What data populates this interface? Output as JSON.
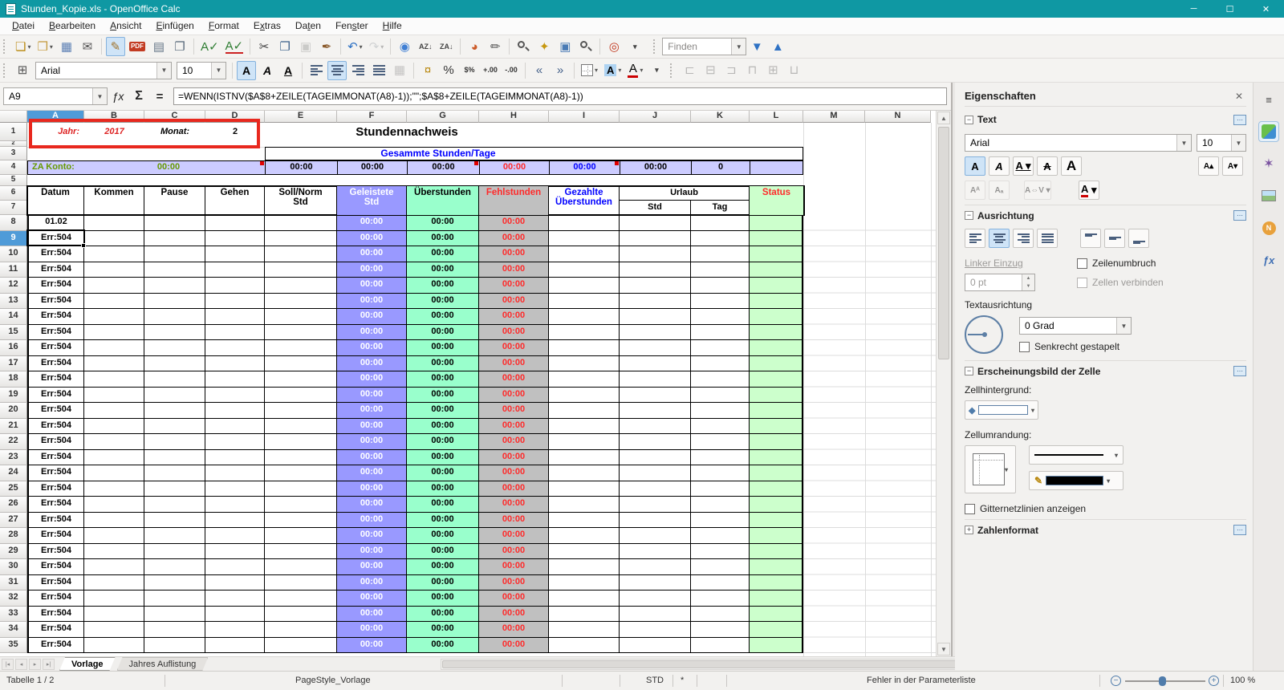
{
  "window": {
    "title": "Stunden_Kopie.xls - OpenOffice Calc",
    "minimize": "─",
    "maximize": "☐",
    "close": "✕"
  },
  "colors": {
    "titlebar": "#0f98a3",
    "selection_blue": "#4f9bd8",
    "lavender": "#ccccff",
    "purple": "#9999ff",
    "mint": "#99ffcc",
    "gray": "#c0c0c0",
    "lightgreen": "#ccffcc",
    "red_text": "#ff2a2a",
    "blue_text": "#0000ff",
    "green_text": "#669900",
    "annotation_red": "#e8281e"
  },
  "menu": {
    "items": [
      {
        "label": "Datei",
        "accel": 0
      },
      {
        "label": "Bearbeiten",
        "accel": 0
      },
      {
        "label": "Ansicht",
        "accel": 0
      },
      {
        "label": "Einfügen",
        "accel": 0
      },
      {
        "label": "Format",
        "accel": 0
      },
      {
        "label": "Extras",
        "accel": 1
      },
      {
        "label": "Daten",
        "accel": 2
      },
      {
        "label": "Fenster",
        "accel": 3
      },
      {
        "label": "Hilfe",
        "accel": 0
      }
    ]
  },
  "toolbar_standard": {
    "buttons": [
      {
        "name": "new-document",
        "glyph": "❏",
        "color": "#b8860b",
        "dropdown": true
      },
      {
        "name": "open",
        "glyph": "❒",
        "color": "#c49a3c",
        "dropdown": true
      },
      {
        "name": "save",
        "glyph": "▦",
        "color": "#5b7fb4"
      },
      {
        "name": "email",
        "glyph": "✉",
        "color": "#555555"
      },
      {
        "sep": true
      },
      {
        "name": "edit-mode",
        "glyph": "✎",
        "color": "#a0722a",
        "active": true
      },
      {
        "name": "export-pdf",
        "text": "PDF",
        "color": "#ffffff",
        "bg": "#c23b22"
      },
      {
        "name": "print",
        "glyph": "▤",
        "color": "#667788"
      },
      {
        "name": "page-preview",
        "glyph": "❐",
        "color": "#556677"
      },
      {
        "sep": true
      },
      {
        "name": "spellcheck",
        "text": "A✓",
        "color": "#2e7d32"
      },
      {
        "name": "auto-spellcheck",
        "text": "A✓",
        "color": "#2e7d32",
        "underline": true
      },
      {
        "sep": true
      },
      {
        "name": "cut",
        "glyph": "✂",
        "color": "#444444"
      },
      {
        "name": "copy",
        "glyph": "❐",
        "color": "#3a5f8a"
      },
      {
        "name": "paste",
        "glyph": "▣",
        "color": "#888888",
        "disabled": true
      },
      {
        "name": "format-paintbrush",
        "glyph": "✒",
        "color": "#8a5a2b"
      },
      {
        "sep": true
      },
      {
        "name": "undo",
        "glyph": "↶",
        "color": "#2f72c4",
        "dropdown": true
      },
      {
        "name": "redo",
        "glyph": "↷",
        "color": "#9aa0a6",
        "disabled": true,
        "dropdown": true
      },
      {
        "sep": true
      },
      {
        "name": "hyperlink",
        "glyph": "◉",
        "color": "#3f7fd4"
      },
      {
        "name": "sort-ascending",
        "text": "AZ↓",
        "color": "#444444",
        "small": true
      },
      {
        "name": "sort-descending",
        "text": "ZA↓",
        "color": "#444444",
        "small": true
      },
      {
        "sep": true
      },
      {
        "name": "insert-chart",
        "glyph": "◕",
        "color": "#cc5a28"
      },
      {
        "name": "draw-functions",
        "glyph": "✏",
        "color": "#555555"
      },
      {
        "sep": true
      },
      {
        "name": "find-replace",
        "lens": true
      },
      {
        "name": "navigator",
        "glyph": "✦",
        "color": "#c79810"
      },
      {
        "name": "gallery",
        "glyph": "▣",
        "color": "#4a7bb5"
      },
      {
        "name": "zoom",
        "lens": true
      },
      {
        "sep": true
      },
      {
        "name": "help",
        "glyph": "◎",
        "color": "#c23b22"
      },
      {
        "name": "toolbar-overflow",
        "glyph": "▾",
        "color": "#444444",
        "small": true
      }
    ],
    "find": {
      "placeholder": "Finden",
      "down_icon": "▼",
      "up_icon": "▲",
      "arrow_color": "#2f72c4"
    }
  },
  "toolbar_formatting": {
    "buttons": [
      {
        "name": "cell-styles",
        "glyph": "⊞",
        "color": "#555555"
      },
      {
        "type": "font-combo"
      },
      {
        "type": "size-combo"
      },
      {
        "sep": true
      },
      {
        "name": "bold",
        "text": "A",
        "cls": "b",
        "active": true
      },
      {
        "name": "italic",
        "text": "A",
        "cls": "i"
      },
      {
        "name": "underline",
        "text": "A",
        "cls": "u"
      },
      {
        "sep": true
      },
      {
        "name": "align-left",
        "bars": "left"
      },
      {
        "name": "align-center",
        "bars": "center",
        "active": true
      },
      {
        "name": "align-right",
        "bars": "right"
      },
      {
        "name": "align-justify",
        "bars": "just"
      },
      {
        "name": "merge-cells",
        "glyph": "▦",
        "color": "#777777",
        "disabled": true
      },
      {
        "sep": true
      },
      {
        "name": "currency",
        "text": "¤",
        "color": "#b8860b"
      },
      {
        "name": "percent",
        "text": "%",
        "color": "#333333"
      },
      {
        "name": "standard-format",
        "text": "$%",
        "color": "#333333",
        "small": true
      },
      {
        "name": "add-decimal-place",
        "text": "+.00",
        "color": "#333333",
        "small": true
      },
      {
        "name": "delete-decimal-place",
        "text": "-.00",
        "color": "#333333",
        "small": true
      },
      {
        "sep": true
      },
      {
        "name": "decrease-indent",
        "text": "«",
        "color": "#44608a"
      },
      {
        "name": "increase-indent",
        "text": "»",
        "color": "#44608a"
      },
      {
        "sep": true
      },
      {
        "name": "borders",
        "border_icon": true,
        "dropdown": true
      },
      {
        "name": "background-color",
        "hlA": "A",
        "dropdown": true
      },
      {
        "name": "font-color",
        "text": "A",
        "colorbar": "#cc0000",
        "dropdown": true
      },
      {
        "name": "toolbar-overflow-2",
        "glyph": "▾",
        "color": "#444444",
        "small": true
      },
      {
        "grip": true
      },
      {
        "name": "align-object-left",
        "glyph": "⊏",
        "color": "#555555",
        "disabled": true
      },
      {
        "name": "align-object-center-h",
        "glyph": "⊟",
        "color": "#555555",
        "disabled": true
      },
      {
        "name": "align-object-right",
        "glyph": "⊐",
        "color": "#555555",
        "disabled": true
      },
      {
        "name": "align-object-top",
        "glyph": "⊓",
        "color": "#555555",
        "disabled": true
      },
      {
        "name": "align-object-center-v",
        "glyph": "⊞",
        "color": "#555555",
        "disabled": true
      },
      {
        "name": "align-object-bottom",
        "glyph": "⊔",
        "color": "#555555",
        "disabled": true
      }
    ]
  },
  "format": {
    "font_name": "Arial",
    "font_size": "10"
  },
  "formula_bar": {
    "cell_reference": "A9",
    "fx_icon": "ƒx",
    "sum_icon": "Σ",
    "equals_icon": "=",
    "formula": "=WENN(ISTNV($A$8+ZEILE(TAGEIMMONAT(A8)-1));\"\";$A$8+ZEILE(TAGEIMMONAT(A8)-1))"
  },
  "sheet": {
    "columns": [
      "A",
      "B",
      "C",
      "D",
      "E",
      "F",
      "G",
      "H",
      "I",
      "J",
      "K",
      "L",
      "M",
      "N"
    ],
    "row_numbers": [
      "1",
      "2",
      "3",
      "4",
      "5",
      "6",
      "7",
      "8",
      "9",
      "10",
      "11",
      "12",
      "13",
      "14",
      "15",
      "16",
      "17",
      "18",
      "19",
      "20",
      "21",
      "22",
      "23",
      "24",
      "25",
      "26",
      "27",
      "28",
      "29",
      "30",
      "31",
      "32",
      "33",
      "34",
      "35"
    ],
    "selected_cell": "A9",
    "selected_column": "A",
    "selected_row": "9",
    "info_row": {
      "jahr_label": "Jahr:",
      "jahr_value": "2017",
      "monat_label": "Monat:",
      "monat_value": "2",
      "title": "Stundennachweis"
    },
    "summary_title": "Gesammte Stunden/Tage",
    "summary_row": {
      "label": "ZA Konto:",
      "value": "00:00",
      "e": "00:00",
      "f": "00:00",
      "g": "00:00",
      "h": "00:00",
      "i": "00:00",
      "j": "00:00",
      "k": "0"
    },
    "headers": {
      "datum": "Datum",
      "kommen": "Kommen",
      "pause": "Pause",
      "gehen": "Gehen",
      "soll1": "Soll/Norm",
      "soll2": "Std",
      "geleistete1": "Geleistete",
      "geleistete2": "Std",
      "ueberstunden": "Überstunden",
      "fehlstunden": "Fehlstunden",
      "gezahlte1": "Gezahlte",
      "gezahlte2": "Überstunden",
      "urlaub": "Urlaub",
      "urlaub_std": "Std",
      "urlaub_tag": "Tag",
      "status": "Status"
    },
    "data_rows": [
      {
        "row": "8",
        "datum": "01.02",
        "geleistete": "00:00",
        "ueberstunden": "00:00",
        "fehlstunden": "00:00"
      },
      {
        "row": "9",
        "datum": "Err:504",
        "geleistete": "00:00",
        "ueberstunden": "00:00",
        "fehlstunden": "00:00"
      },
      {
        "row": "10",
        "datum": "Err:504",
        "geleistete": "00:00",
        "ueberstunden": "00:00",
        "fehlstunden": "00:00"
      },
      {
        "row": "11",
        "datum": "Err:504",
        "geleistete": "00:00",
        "ueberstunden": "00:00",
        "fehlstunden": "00:00"
      },
      {
        "row": "12",
        "datum": "Err:504",
        "geleistete": "00:00",
        "ueberstunden": "00:00",
        "fehlstunden": "00:00"
      },
      {
        "row": "13",
        "datum": "Err:504",
        "geleistete": "00:00",
        "ueberstunden": "00:00",
        "fehlstunden": "00:00"
      },
      {
        "row": "14",
        "datum": "Err:504",
        "geleistete": "00:00",
        "ueberstunden": "00:00",
        "fehlstunden": "00:00"
      },
      {
        "row": "15",
        "datum": "Err:504",
        "geleistete": "00:00",
        "ueberstunden": "00:00",
        "fehlstunden": "00:00"
      },
      {
        "row": "16",
        "datum": "Err:504",
        "geleistete": "00:00",
        "ueberstunden": "00:00",
        "fehlstunden": "00:00"
      },
      {
        "row": "17",
        "datum": "Err:504",
        "geleistete": "00:00",
        "ueberstunden": "00:00",
        "fehlstunden": "00:00"
      },
      {
        "row": "18",
        "datum": "Err:504",
        "geleistete": "00:00",
        "ueberstunden": "00:00",
        "fehlstunden": "00:00"
      },
      {
        "row": "19",
        "datum": "Err:504",
        "geleistete": "00:00",
        "ueberstunden": "00:00",
        "fehlstunden": "00:00"
      },
      {
        "row": "20",
        "datum": "Err:504",
        "geleistete": "00:00",
        "ueberstunden": "00:00",
        "fehlstunden": "00:00"
      },
      {
        "row": "21",
        "datum": "Err:504",
        "geleistete": "00:00",
        "ueberstunden": "00:00",
        "fehlstunden": "00:00"
      },
      {
        "row": "22",
        "datum": "Err:504",
        "geleistete": "00:00",
        "ueberstunden": "00:00",
        "fehlstunden": "00:00"
      },
      {
        "row": "23",
        "datum": "Err:504",
        "geleistete": "00:00",
        "ueberstunden": "00:00",
        "fehlstunden": "00:00"
      },
      {
        "row": "24",
        "datum": "Err:504",
        "geleistete": "00:00",
        "ueberstunden": "00:00",
        "fehlstunden": "00:00"
      },
      {
        "row": "25",
        "datum": "Err:504",
        "geleistete": "00:00",
        "ueberstunden": "00:00",
        "fehlstunden": "00:00"
      },
      {
        "row": "26",
        "datum": "Err:504",
        "geleistete": "00:00",
        "ueberstunden": "00:00",
        "fehlstunden": "00:00"
      },
      {
        "row": "27",
        "datum": "Err:504",
        "geleistete": "00:00",
        "ueberstunden": "00:00",
        "fehlstunden": "00:00"
      },
      {
        "row": "28",
        "datum": "Err:504",
        "geleistete": "00:00",
        "ueberstunden": "00:00",
        "fehlstunden": "00:00"
      },
      {
        "row": "29",
        "datum": "Err:504",
        "geleistete": "00:00",
        "ueberstunden": "00:00",
        "fehlstunden": "00:00"
      },
      {
        "row": "30",
        "datum": "Err:504",
        "geleistete": "00:00",
        "ueberstunden": "00:00",
        "fehlstunden": "00:00"
      },
      {
        "row": "31",
        "datum": "Err:504",
        "geleistete": "00:00",
        "ueberstunden": "00:00",
        "fehlstunden": "00:00"
      },
      {
        "row": "32",
        "datum": "Err:504",
        "geleistete": "00:00",
        "ueberstunden": "00:00",
        "fehlstunden": "00:00"
      },
      {
        "row": "33",
        "datum": "Err:504",
        "geleistete": "00:00",
        "ueberstunden": "00:00",
        "fehlstunden": "00:00"
      },
      {
        "row": "34",
        "datum": "Err:504",
        "geleistete": "00:00",
        "ueberstunden": "00:00",
        "fehlstunden": "00:00"
      },
      {
        "row": "35",
        "datum": "Err:504",
        "geleistete": "00:00",
        "ueberstunden": "00:00",
        "fehlstunden": "00:00"
      }
    ]
  },
  "tabs": {
    "nav_icons": [
      "|◂",
      "◂",
      "▸",
      "▸|"
    ],
    "items": [
      {
        "label": "Vorlage",
        "active": true
      },
      {
        "label": "Jahres Auflistung",
        "active": false
      }
    ]
  },
  "statusbar": {
    "sheet_info": "Tabelle 1 / 2",
    "page_style": "PageStyle_Vorlage",
    "mode": "STD",
    "modified_flag": "*",
    "message": "Fehler in der Parameterliste",
    "zoom_value": "100 %",
    "zoom_out_icon": "−",
    "zoom_in_icon": "+"
  },
  "sidebar": {
    "title": "Eigenschaften",
    "close_icon": "✕",
    "menu_icon": "≡",
    "text_section": {
      "label": "Text",
      "font_name": "Arial",
      "font_size": "10"
    },
    "alignment_section": {
      "label": "Ausrichtung",
      "left_indent_label": "Linker Einzug",
      "left_indent_value": "0 pt",
      "wrap_label": "Zeilenumbruch",
      "merge_label": "Zellen verbinden",
      "orientation_label": "Textausrichtung",
      "degrees_value": "0 Grad",
      "stacked_label": "Senkrecht gestapelt"
    },
    "appearance_section": {
      "label": "Erscheinungsbild der Zelle",
      "background_label": "Zellhintergrund:",
      "border_label": "Zellumrandung:",
      "gridlines_label": "Gitternetzlinien anzeigen"
    },
    "number_section": {
      "label": "Zahlenformat"
    },
    "strip": {
      "tabs": [
        "properties",
        "styles",
        "gallery",
        "navigator",
        "functions"
      ]
    }
  }
}
